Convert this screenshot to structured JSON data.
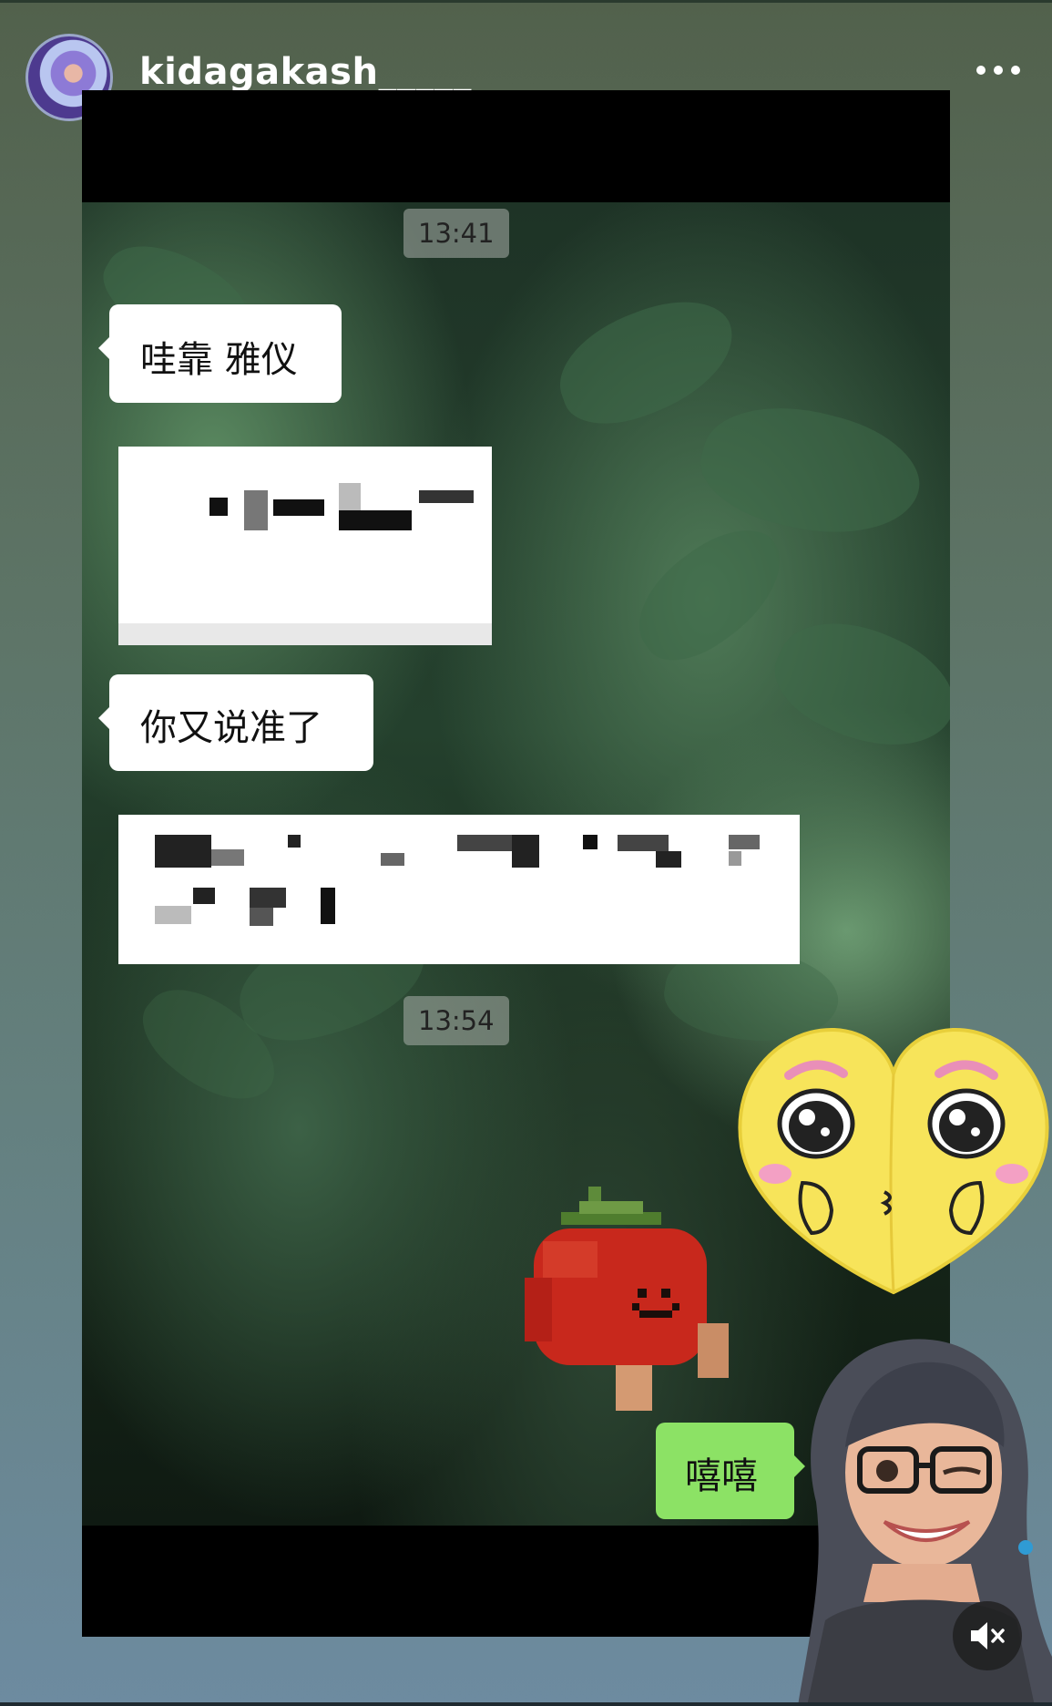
{
  "header": {
    "username": "kidagakash_____",
    "more_icon": "more-horizontal-icon"
  },
  "chat": {
    "timestamps": [
      "13:41",
      "13:54"
    ],
    "messages": [
      {
        "side": "left",
        "text": "哇靠 雅仪"
      },
      {
        "side": "left",
        "text": "你又说准了"
      },
      {
        "side": "right",
        "text": "嘻嘻"
      }
    ]
  },
  "stickers": {
    "tomato": "tomato-sticker",
    "heart": "heart-face-sticker",
    "memoji": "winking-memoji-sticker"
  },
  "controls": {
    "mute_icon": "speaker-muted-icon"
  },
  "colors": {
    "bubble_green": "#8ce265",
    "bubble_white": "#ffffff",
    "frame": "#000000"
  }
}
